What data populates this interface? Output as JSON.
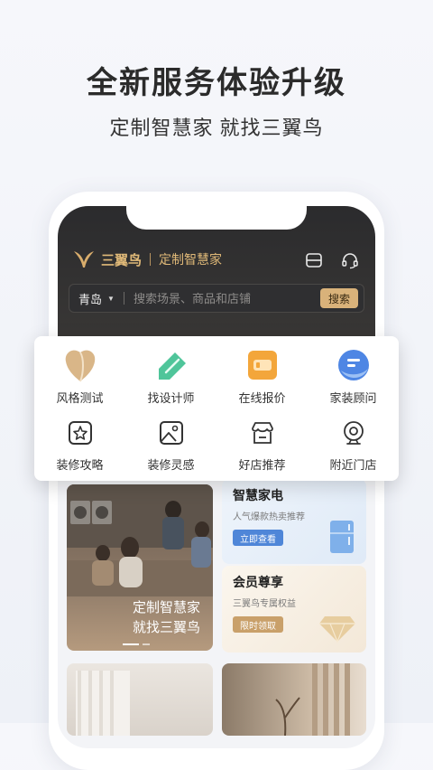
{
  "promo": {
    "headline": "全新服务体验升级",
    "subline": "定制智慧家 就找三翼鸟"
  },
  "app": {
    "brand": "三翼鸟",
    "tagline": "定制智慧家",
    "city": "青岛",
    "search_placeholder": "搜索场景、商品和店铺",
    "search_button": "搜索"
  },
  "services": {
    "row1": [
      {
        "label": "风格测试",
        "icon": "style-test-icon"
      },
      {
        "label": "找设计师",
        "icon": "designer-icon"
      },
      {
        "label": "在线报价",
        "icon": "quote-icon"
      },
      {
        "label": "家装顾问",
        "icon": "consultant-icon"
      }
    ],
    "row2": [
      {
        "label": "装修攻略",
        "icon": "star-guide-icon"
      },
      {
        "label": "装修灵感",
        "icon": "image-icon"
      },
      {
        "label": "好店推荐",
        "icon": "store-icon"
      },
      {
        "label": "附近门店",
        "icon": "location-camera-icon"
      }
    ]
  },
  "banner": {
    "line1": "定制智慧家",
    "line2": "就找三翼鸟"
  },
  "cards": {
    "appliance": {
      "title": "智慧家电",
      "subtitle": "人气爆款热卖推荐",
      "button": "立即查看"
    },
    "vip": {
      "title": "会员尊享",
      "subtitle": "三翼鸟专属权益",
      "button": "限时领取"
    }
  },
  "colors": {
    "gold": "#e0b978",
    "dark_header": "#2b2b2d",
    "appliance_blue": "#4f86d8",
    "vip_gold": "#c9a06a"
  }
}
